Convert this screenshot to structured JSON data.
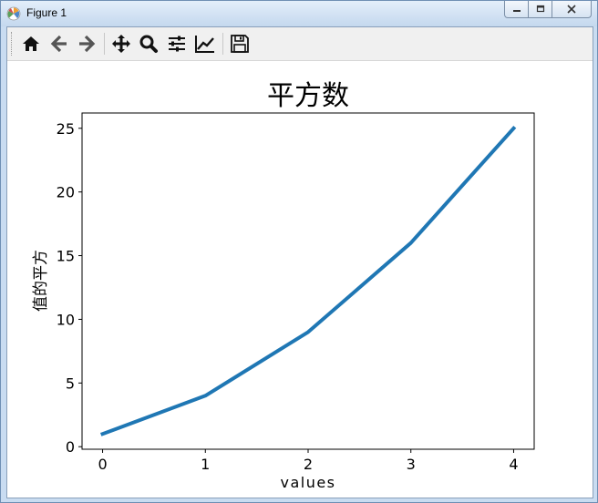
{
  "window": {
    "title": "Figure 1",
    "app_icon": "matplotlib-icon",
    "controls": [
      "minimize-icon",
      "maximize-icon",
      "close-icon"
    ]
  },
  "toolbar": {
    "buttons": [
      {
        "name": "home",
        "icon": "home-icon"
      },
      {
        "name": "back",
        "icon": "arrow-left-icon"
      },
      {
        "name": "forward",
        "icon": "arrow-right-icon"
      },
      {
        "name": "pan",
        "icon": "move-icon"
      },
      {
        "name": "zoom",
        "icon": "magnifier-icon"
      },
      {
        "name": "subplots",
        "icon": "sliders-icon"
      },
      {
        "name": "edit-axis",
        "icon": "line-chart-icon"
      },
      {
        "name": "save",
        "icon": "floppy-disk-icon"
      }
    ]
  },
  "chart_data": {
    "type": "line",
    "title": "平方数",
    "xlabel": "values",
    "ylabel": "值的平方",
    "x": [
      0,
      1,
      2,
      3,
      4
    ],
    "series": [
      {
        "values": [
          1,
          4,
          9,
          16,
          25
        ],
        "color": "#1f77b4"
      }
    ],
    "xticks": [
      "0",
      "1",
      "2",
      "3",
      "4"
    ],
    "yticks": [
      "0",
      "5",
      "10",
      "15",
      "20",
      "25"
    ],
    "xlim": [
      -0.2,
      4.2
    ],
    "ylim": [
      -0.2,
      26.2
    ],
    "grid": false,
    "legend": "none"
  }
}
